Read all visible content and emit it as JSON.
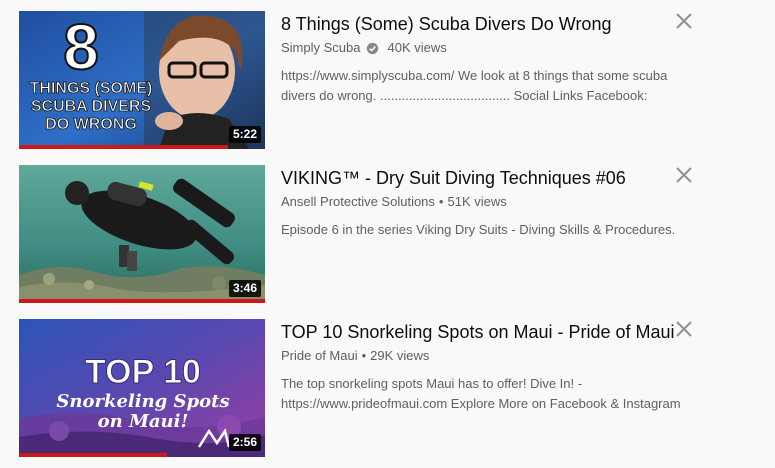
{
  "videos": [
    {
      "title": "8 Things (Some) Scuba Divers Do Wrong",
      "channel": "Simply Scuba",
      "verified": true,
      "views": "40K views",
      "description": "https://www.simplyscuba.com/ We look at 8 things that some scuba divers do wrong. .................................... Social Links Facebook:",
      "duration": "5:22",
      "watched_fraction": 0.85,
      "thumb_text": {
        "number": "8",
        "line1": "THINGS (SOME)",
        "line2": "SCUBA DIVERS",
        "line3": "DO WRONG"
      }
    },
    {
      "title": "VIKING™ - Dry Suit Diving Techniques #06",
      "channel": "Ansell Protective Solutions",
      "separator": "•",
      "views": "51K views",
      "description": "Episode 6 in the series Viking Dry Suits - Diving Skills & Procedures.",
      "duration": "3:46",
      "watched_fraction": 1.0
    },
    {
      "title": "TOP 10 Snorkeling Spots on Maui - Pride of Maui",
      "channel": "Pride of Maui",
      "separator": "•",
      "views": "29K views",
      "description": "The top snorkeling spots Maui has to offer! Dive In! - https://www.prideofmaui.com Explore More on Facebook & Instagram",
      "duration": "2:56",
      "watched_fraction": 0.6,
      "thumb_text": {
        "line1": "TOP 10",
        "line2": "Snorkeling Spots",
        "line3": "on Maui!"
      }
    }
  ],
  "colors": {
    "progress": "#cc1a1a",
    "title": "#0d0d0d",
    "meta": "#606060"
  },
  "icons": {
    "dismiss": "close-icon",
    "verified": "verified-check-icon"
  }
}
